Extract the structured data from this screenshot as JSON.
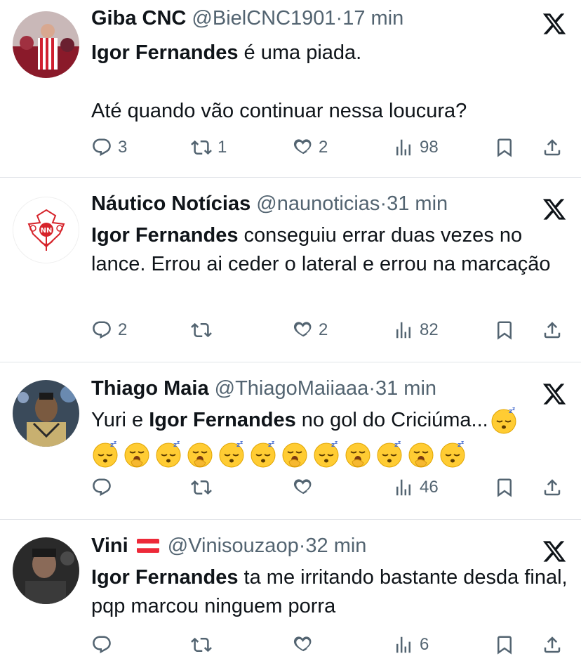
{
  "tweets": [
    {
      "name": "Giba CNC",
      "handle": "@BielCNC1901",
      "sep": "·",
      "time": "17 min",
      "mention": "Igor Fernandes",
      "text_after": " é uma piada.",
      "text_line2": "Até quando vão continuar nessa loucura?",
      "replies": "3",
      "reposts": "1",
      "likes": "2",
      "views": "98"
    },
    {
      "name": "Náutico Notícias",
      "handle": "@naunoticias",
      "sep": "·",
      "time": "31 min",
      "mention": "Igor Fernandes",
      "text_after": " conseguiu errar duas vezes no lance. Errou ai ceder o lateral e errou na marcação",
      "replies": "2",
      "reposts": "",
      "likes": "2",
      "views": "82"
    },
    {
      "name": "Thiago Maia",
      "handle": "@ThiagoMaiiaaa",
      "sep": "·",
      "time": "31 min",
      "text_before": "Yuri e ",
      "mention": "Igor Fernandes",
      "text_after": " no gol do Criciúma...",
      "emojis": [
        "sleeping-face",
        "sleeping-face",
        "yawning-face",
        "sleeping-face",
        "yawning-face",
        "sleeping-face",
        "sleeping-face",
        "yawning-face",
        "sleeping-face",
        "yawning-face",
        "sleeping-face",
        "yawning-face",
        "sleeping-face"
      ],
      "replies": "",
      "reposts": "",
      "likes": "",
      "views": "46"
    },
    {
      "name": "Vini",
      "flag": "austria-flag",
      "handle": "@Vinisouzaop",
      "sep": "·",
      "time": "32 min",
      "mention": "Igor Fernandes",
      "text_after": " ta me irritando bastante desda final, pqp marcou ninguem porra",
      "replies": "",
      "reposts": "",
      "likes": "",
      "views": "6"
    }
  ],
  "colors": {
    "text": "#0f1419",
    "muted": "#536471",
    "divider": "#e1e4e8",
    "nautico_red": "#d6232a"
  }
}
